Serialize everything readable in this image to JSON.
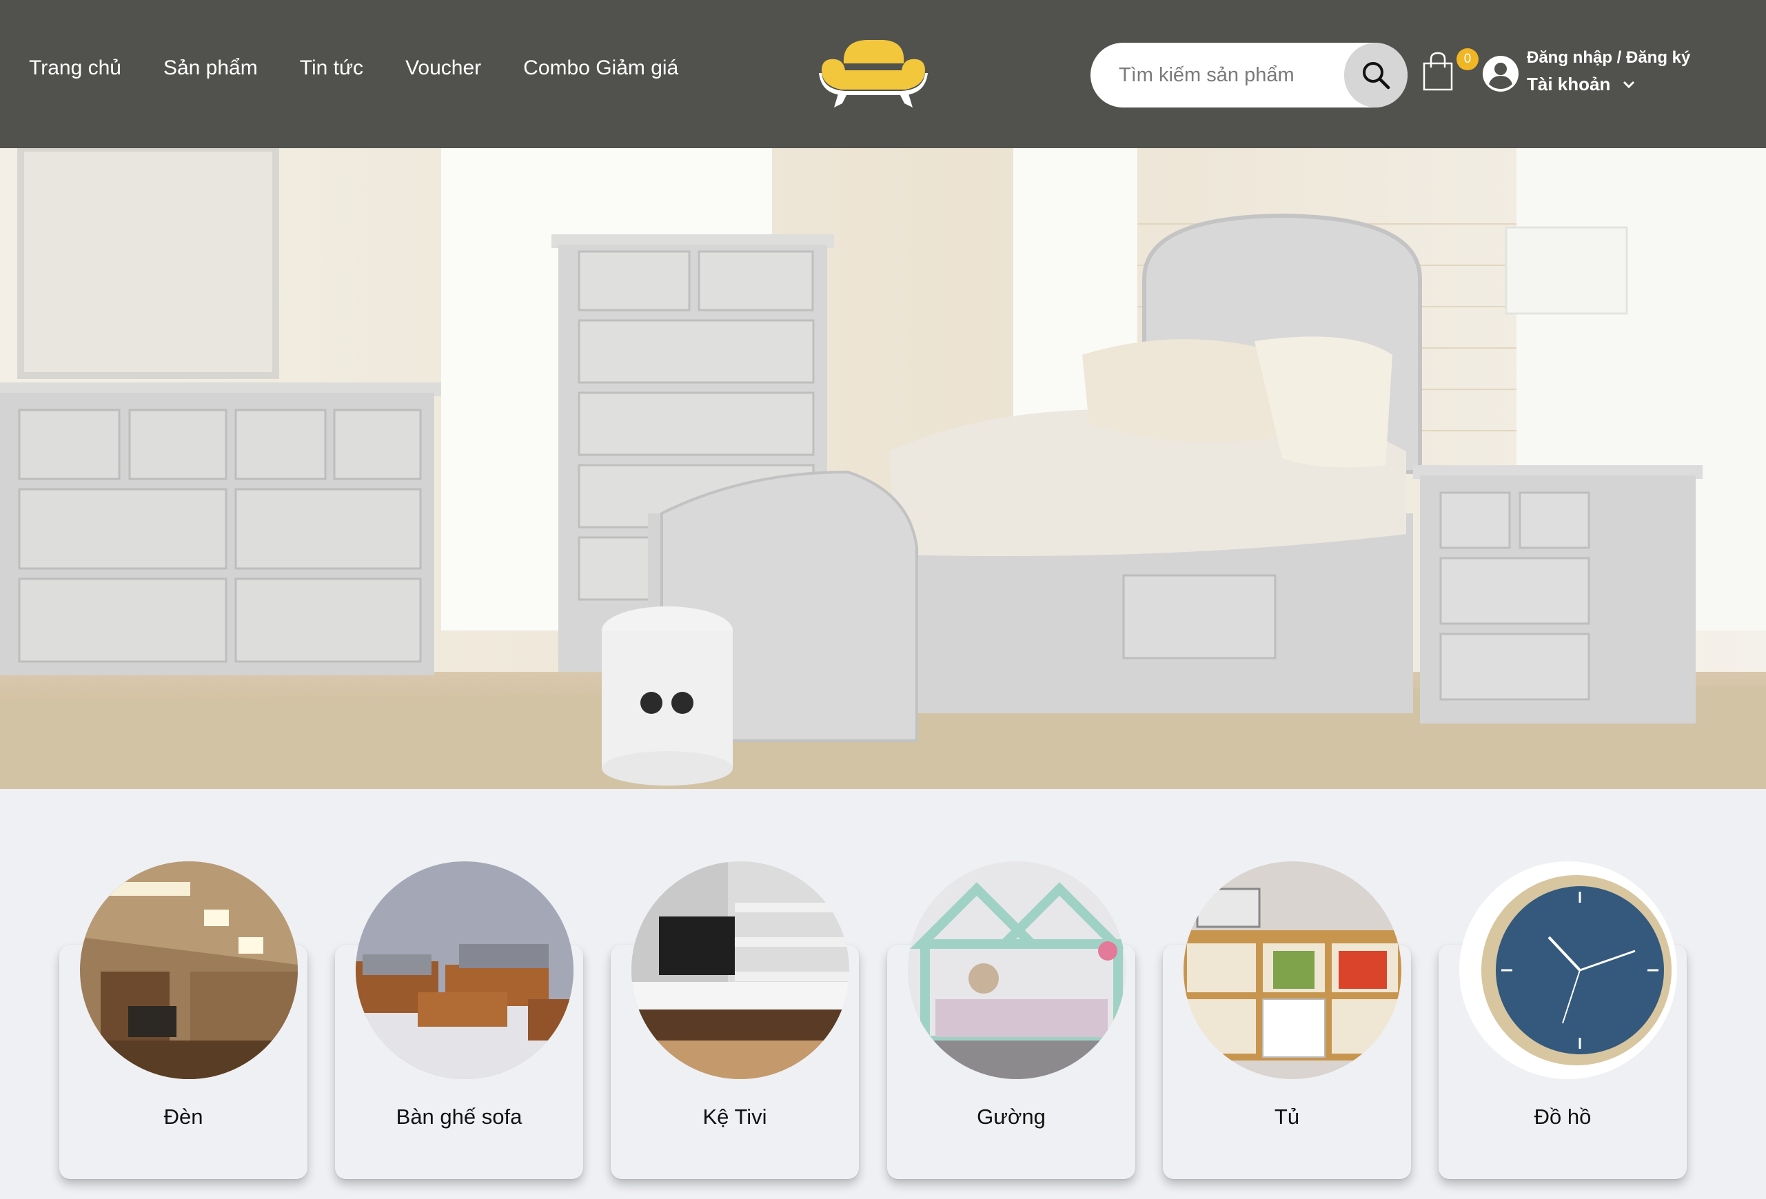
{
  "header": {
    "nav": [
      "Trang chủ",
      "Sản phẩm",
      "Tin tức",
      "Voucher",
      "Combo Giảm giá"
    ],
    "logo_icon": "sofa-logo-icon",
    "search": {
      "placeholder": "Tìm kiếm sản phẩm",
      "icon": "search-icon"
    },
    "cart": {
      "icon": "shopping-bag-icon",
      "count": "0"
    },
    "account": {
      "icon": "user-circle-icon",
      "login_label": "Đăng nhập / Đăng ký",
      "menu_label": "Tài khoản",
      "menu_icon": "chevron-down-icon"
    }
  },
  "hero": {
    "image": "bedroom-furniture-banner"
  },
  "categories": [
    {
      "label": "Đèn",
      "image": "ceiling-lights-room"
    },
    {
      "label": "Bàn ghế sofa",
      "image": "wooden-sofa-set"
    },
    {
      "label": "Kệ Tivi",
      "image": "tv-shelf"
    },
    {
      "label": "Gường",
      "image": "kids-house-bed"
    },
    {
      "label": "Tủ",
      "image": "kitchen-cabinet"
    },
    {
      "label": "Đồ hồ",
      "image": "wall-clock"
    }
  ],
  "colors": {
    "header_bg": "#51524d",
    "badge": "#f1b623",
    "logo": "#f2c73c",
    "page_bg": "#eff0f3"
  }
}
